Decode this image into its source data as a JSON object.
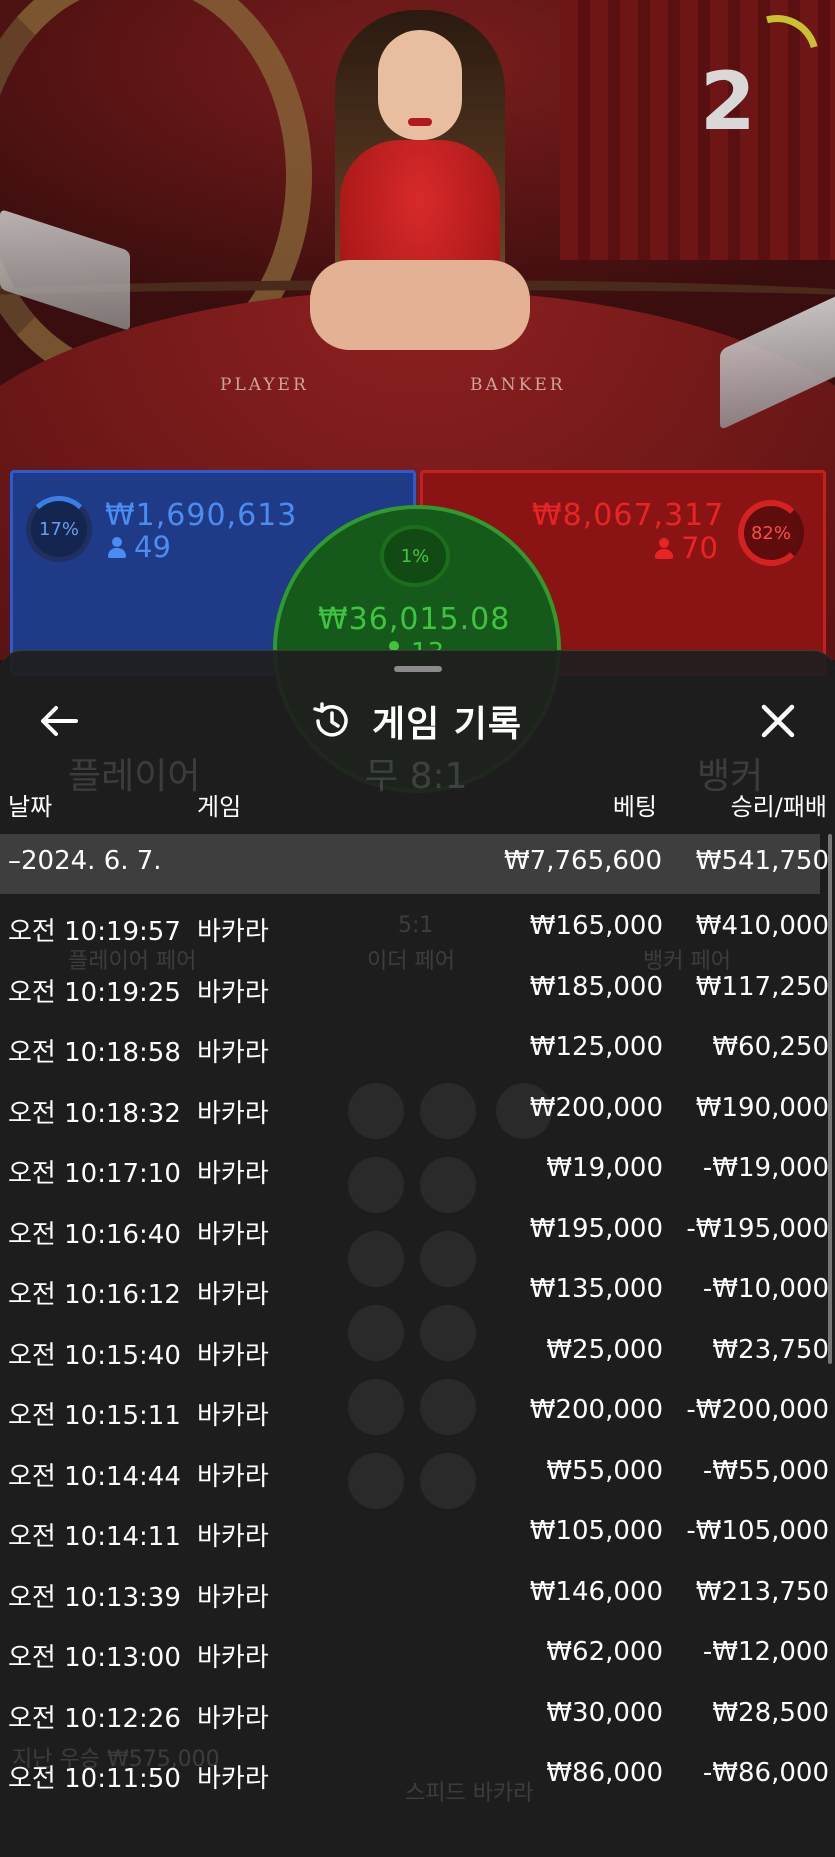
{
  "video": {
    "countdown": "2",
    "table_left_word": "PLAYER",
    "table_right_word": "BANKER"
  },
  "bets": {
    "player": {
      "percent": "17%",
      "amount": "₩1,690,613",
      "players": "49",
      "color": "#2e5ad0"
    },
    "banker": {
      "percent": "82%",
      "amount": "₩8,067,317",
      "players": "70",
      "color": "#c52020"
    },
    "tie": {
      "percent": "1%",
      "amount": "₩36,015.08",
      "players": "13",
      "color": "#2f9b2f"
    }
  },
  "background_ui": {
    "player_label": "플레이어",
    "tie_label": "무 8:1",
    "banker_label": "뱅커",
    "player_pair": "플레이어 페어",
    "either_pair": "이더 페어",
    "banker_pair": "뱅커 페어",
    "either_odds": "5:1",
    "last_win": "지난 우승 ₩575,000",
    "table_name": "스피드 바카라"
  },
  "history": {
    "title": "게임 기록",
    "columns": {
      "date": "날짜",
      "game": "게임",
      "bet": "베팅",
      "winloss": "승리/패배"
    },
    "day": {
      "date": "–2024. 6. 7.",
      "bet_total": "₩7,765,600",
      "winloss_total": "₩541,750"
    },
    "rows": [
      {
        "time": "오전 10:19:57",
        "game": "바카라",
        "bet": "₩165,000",
        "winloss": "₩410,000"
      },
      {
        "time": "오전 10:19:25",
        "game": "바카라",
        "bet": "₩185,000",
        "winloss": "₩117,250"
      },
      {
        "time": "오전 10:18:58",
        "game": "바카라",
        "bet": "₩125,000",
        "winloss": "₩60,250"
      },
      {
        "time": "오전 10:18:32",
        "game": "바카라",
        "bet": "₩200,000",
        "winloss": "₩190,000"
      },
      {
        "time": "오전 10:17:10",
        "game": "바카라",
        "bet": "₩19,000",
        "winloss": "-₩19,000"
      },
      {
        "time": "오전 10:16:40",
        "game": "바카라",
        "bet": "₩195,000",
        "winloss": "-₩195,000"
      },
      {
        "time": "오전 10:16:12",
        "game": "바카라",
        "bet": "₩135,000",
        "winloss": "-₩10,000"
      },
      {
        "time": "오전 10:15:40",
        "game": "바카라",
        "bet": "₩25,000",
        "winloss": "₩23,750"
      },
      {
        "time": "오전 10:15:11",
        "game": "바카라",
        "bet": "₩200,000",
        "winloss": "-₩200,000"
      },
      {
        "time": "오전 10:14:44",
        "game": "바카라",
        "bet": "₩55,000",
        "winloss": "-₩55,000"
      },
      {
        "time": "오전 10:14:11",
        "game": "바카라",
        "bet": "₩105,000",
        "winloss": "-₩105,000"
      },
      {
        "time": "오전 10:13:39",
        "game": "바카라",
        "bet": "₩146,000",
        "winloss": "₩213,750"
      },
      {
        "time": "오전 10:13:00",
        "game": "바카라",
        "bet": "₩62,000",
        "winloss": "-₩12,000"
      },
      {
        "time": "오전 10:12:26",
        "game": "바카라",
        "bet": "₩30,000",
        "winloss": "₩28,500"
      },
      {
        "time": "오전 10:11:50",
        "game": "바카라",
        "bet": "₩86,000",
        "winloss": "-₩86,000"
      }
    ]
  },
  "icons": {
    "back": "arrow-left-icon",
    "history": "history-clock-icon",
    "close": "close-icon"
  }
}
